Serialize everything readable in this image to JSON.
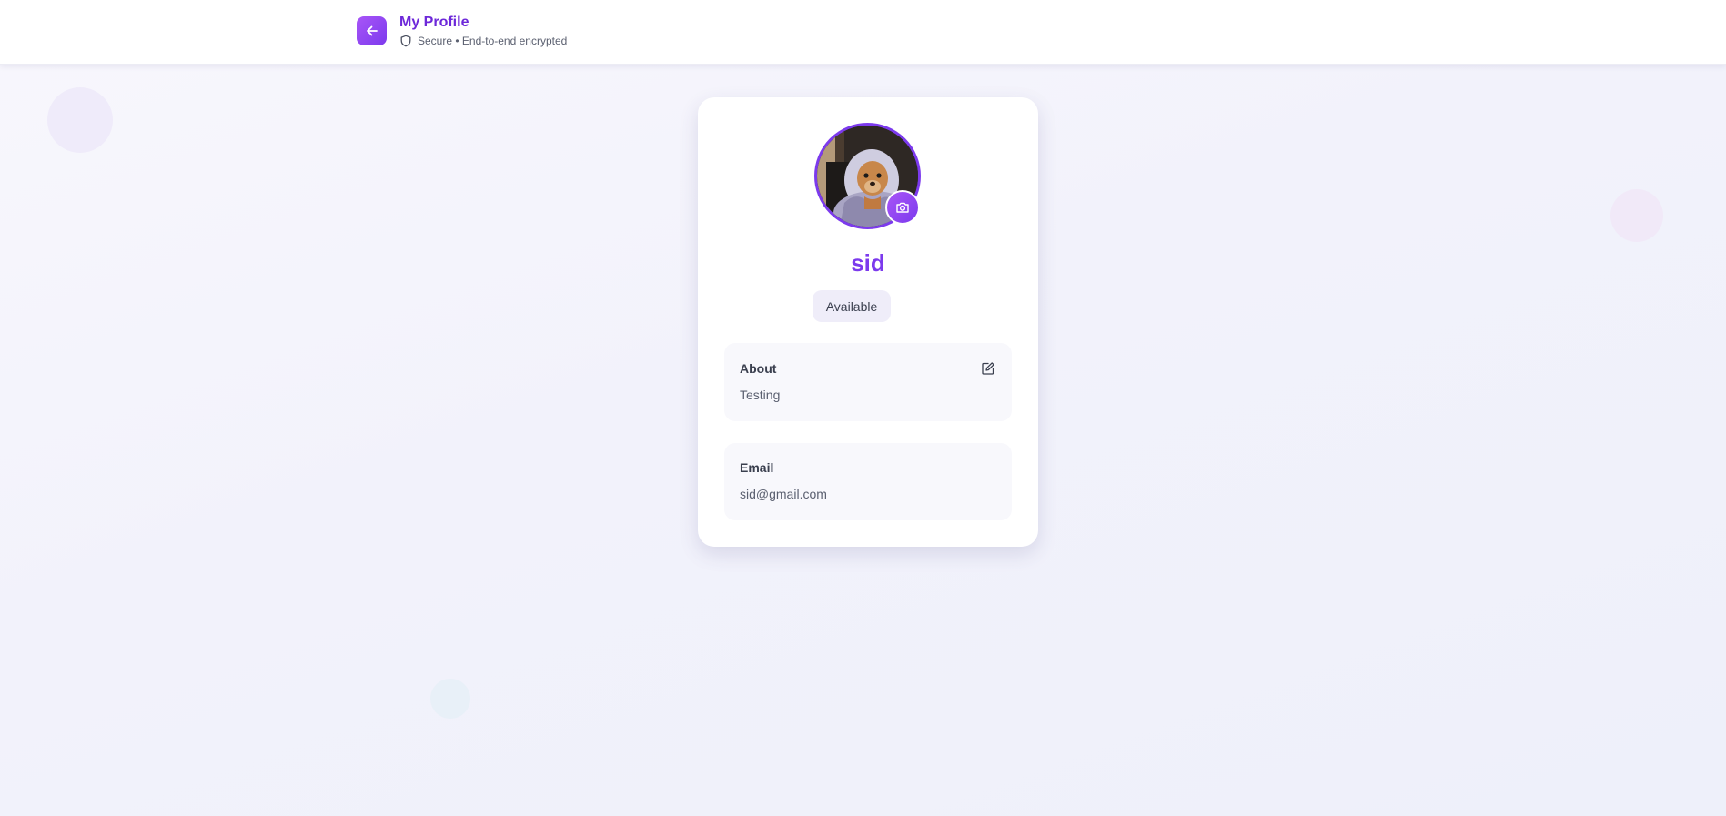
{
  "header": {
    "title": "My Profile",
    "subtitle": "Secure • End-to-end encrypted",
    "back_icon": "arrow-left-icon",
    "security_icon": "shield-icon"
  },
  "profile": {
    "name": "sid",
    "status": "Available",
    "avatar_alt": "profile photo of a small dog wrapped in a blanket",
    "camera_icon": "camera-icon"
  },
  "about": {
    "label": "About",
    "value": "Testing",
    "edit_icon": "edit-icon"
  },
  "email": {
    "label": "Email",
    "value": "sid@gmail.com"
  },
  "colors": {
    "accent": "#7c3aed",
    "accent_light": "#a855f7",
    "title": "#6d28d9"
  }
}
